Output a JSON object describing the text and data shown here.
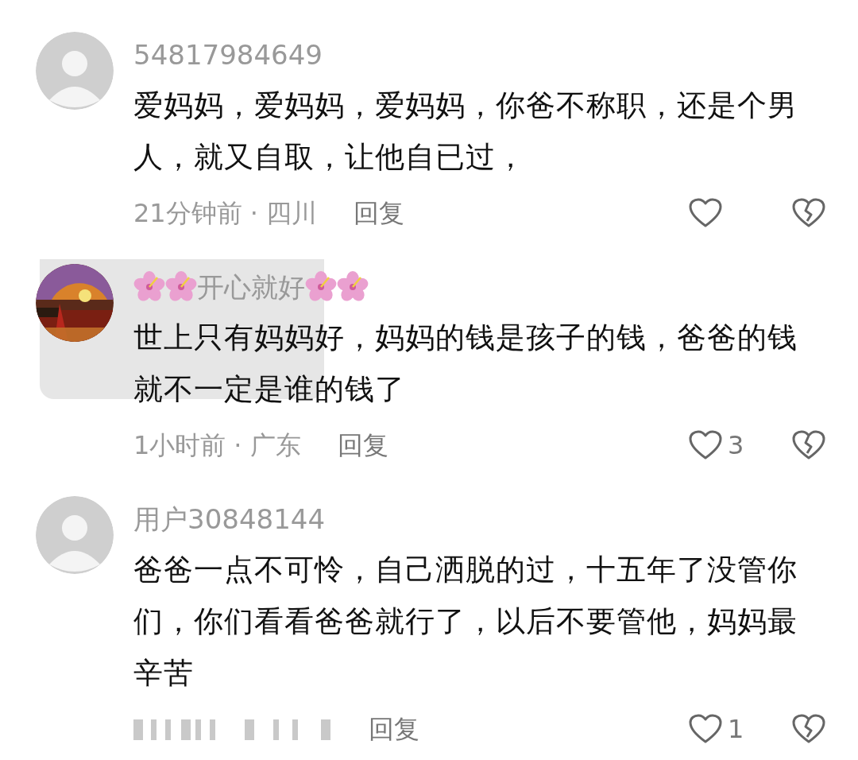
{
  "comments": [
    {
      "avatar": {
        "kind": "default"
      },
      "name": "54817984649",
      "text": "爱妈妈，爱妈妈，爱妈妈，你爸不称职，还是个男人，就又自取，让他自已过，",
      "time": "21分钟前",
      "separator": "·",
      "region": "四川",
      "reply": "回复",
      "time_blurred": false
    },
    {
      "avatar": {
        "kind": "picture"
      },
      "name": "开心就好",
      "decor_before": [
        {
          "kind": "hibiscus"
        },
        {
          "kind": "hibiscus"
        }
      ],
      "decor_after": [
        {
          "kind": "hibiscus"
        },
        {
          "kind": "hibiscus"
        }
      ],
      "text": "世上只有妈妈好，妈妈的钱是孩子的钱，爸爸的钱就不一定是谁的钱了",
      "time": "1小时前",
      "separator": "·",
      "region": "广东",
      "reply": "回复",
      "likes": "3",
      "time_blurred": false
    },
    {
      "avatar": {
        "kind": "default"
      },
      "name": "用户30848144",
      "text": "爸爸一点不可怜，自己洒脱的过，十五年了没管你们，你们看看爸爸就行了，以后不要管他，妈妈最辛苦",
      "reply": "回复",
      "likes": "1",
      "time_blurred": true
    }
  ]
}
